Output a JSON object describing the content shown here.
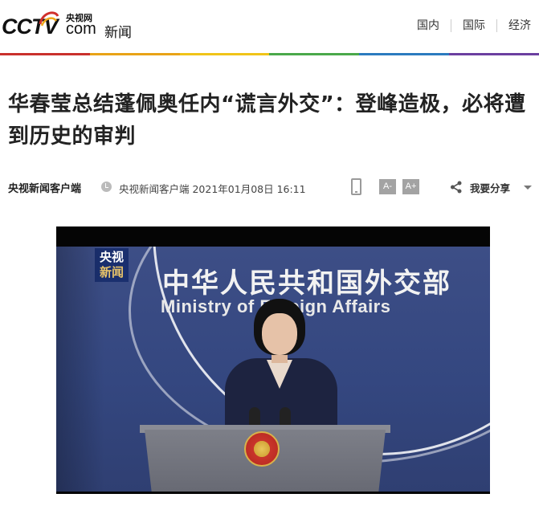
{
  "header": {
    "logo_text": "CCTV",
    "logo_small": "央视网",
    "logo_com": "com",
    "section": "新闻",
    "nav": [
      {
        "label": "国内"
      },
      {
        "label": "国际"
      },
      {
        "label": "经济"
      }
    ],
    "rainbow_colors": [
      "#c9302c",
      "#e8a317",
      "#f0c419",
      "#4aa84a",
      "#2b7bbf",
      "#6b3fa0"
    ]
  },
  "article": {
    "title": "华春莹总结蓬佩奥任内“谎言外交”：登峰造极，必将遭到历史的审判",
    "source": "央视新闻客户端",
    "pub_info": "央视新闻客户端 2021年01月08日 16:11",
    "font_small": "A-",
    "font_large": "A+",
    "share_label": "我要分享"
  },
  "video": {
    "badge_line1": "央视",
    "badge_line2": "新闻",
    "backdrop_cn": "中华人民共和国外交部",
    "backdrop_en": "Ministry of Foreign Affairs"
  }
}
